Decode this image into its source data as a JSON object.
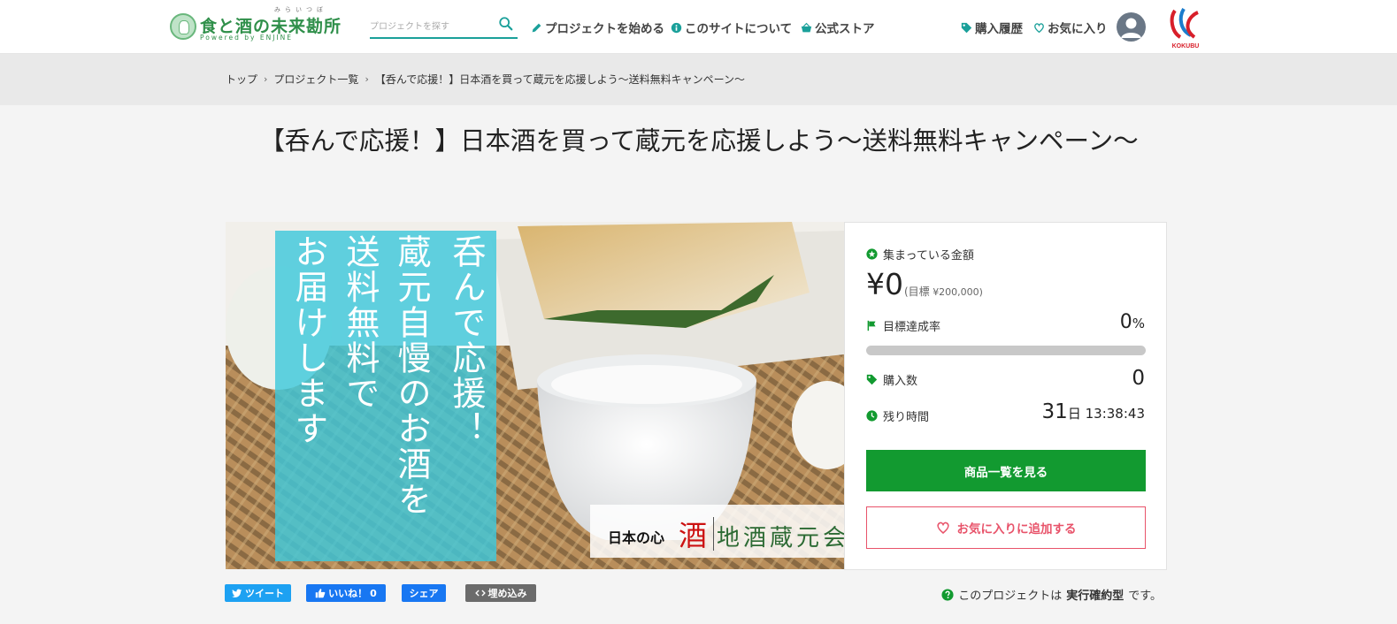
{
  "header": {
    "logo": {
      "title": "食と酒の未来勘所",
      "ruby": "みらいつぼ",
      "subtitle": "Powered by ENJINE"
    },
    "search": {
      "placeholder": "プロジェクトを探す"
    },
    "nav": {
      "start_project": "プロジェクトを始める",
      "about": "このサイトについて",
      "store": "公式ストア",
      "history": "購入履歴",
      "favorites": "お気に入り"
    },
    "brand_label": "KOKUBU",
    "icons": [
      "search-icon",
      "pencil-icon",
      "info-icon",
      "basket-icon",
      "tag-icon",
      "heart-icon",
      "user-icon"
    ]
  },
  "breadcrumb": {
    "items": [
      "トップ",
      "プロジェクト一覧",
      "【呑んで応援！】日本酒を買って蔵元を応援しよう～送料無料キャンペーン～"
    ],
    "separator": "›"
  },
  "title": "【呑んで応援！】日本酒を買って蔵元を応援しよう～送料無料キャンペーン～",
  "hero": {
    "lines": [
      "呑んで応援！",
      "蔵元自慢のお酒を",
      "送料無料で",
      "お届けします"
    ],
    "logo_a": "日本の心",
    "logo_b": "酒",
    "logo_c": "地酒蔵元会"
  },
  "stats": {
    "collected_label": "集まっている金額",
    "amount": "¥0",
    "goal_prefix": "(目標",
    "goal_value": "¥200,000)",
    "rate_label": "目標達成率",
    "rate_value": "0",
    "rate_unit": "%",
    "rate_fraction": 0,
    "purchases_label": "購入数",
    "purchases_value": "0",
    "remaining_label": "残り時間",
    "remaining_days": "31",
    "remaining_days_unit": "日",
    "remaining_time": "13:38:43",
    "primary_button": "商品一覧を見る",
    "favorite_button": "お気に入りに追加する"
  },
  "social": {
    "tweet": "ツイート",
    "like": "いいね！",
    "like_count": "0",
    "share": "シェア",
    "embed": "埋め込み"
  },
  "note": {
    "prefix": "このプロジェクトは",
    "bold": "実行確約型",
    "suffix": "です。"
  },
  "colors": {
    "accent_green": "#129a30",
    "favorite_pink": "#e8536a",
    "twitter": "#1da1f2",
    "facebook": "#1877f2",
    "embed_gray": "#6b6b6b",
    "hero_panel": "#3ec8dc"
  }
}
